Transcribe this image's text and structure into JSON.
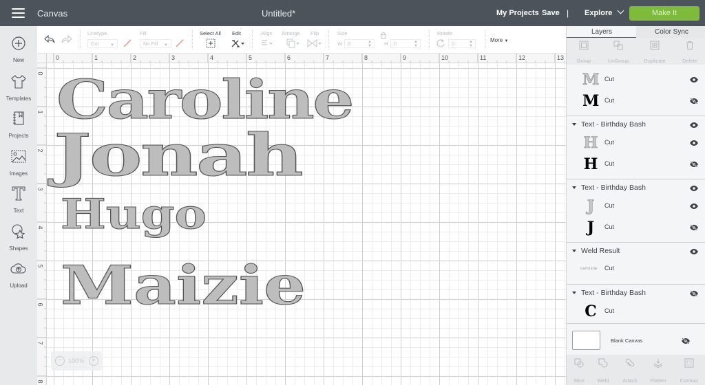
{
  "header": {
    "app_name": "Canvas",
    "doc_title": "Untitled*",
    "my_projects": "My Projects",
    "save": "Save",
    "separator": "|",
    "explore": "Explore",
    "make_it": "Make It",
    "bg_color": "#4c535a",
    "accent_color": "#7dbb3a"
  },
  "sidebar": {
    "items": [
      {
        "label": "New",
        "icon": "plus-circle-icon"
      },
      {
        "label": "Templates",
        "icon": "tshirt-icon"
      },
      {
        "label": "Projects",
        "icon": "notebook-icon"
      },
      {
        "label": "Images",
        "icon": "image-icon"
      },
      {
        "label": "Text",
        "icon": "text-icon"
      },
      {
        "label": "Shapes",
        "icon": "shapes-icon"
      },
      {
        "label": "Upload",
        "icon": "cloud-upload-icon"
      }
    ]
  },
  "toolbar": {
    "linetype_label": "Linetype",
    "linetype_value": "Cut",
    "fill_label": "Fill",
    "fill_value": "No Fill",
    "select_all": "Select All",
    "edit": "Edit",
    "align": "Align",
    "arrange": "Arrange",
    "flip": "Flip",
    "size": "Size",
    "w_label": "W",
    "w_value": "0",
    "h_label": "H",
    "h_value": "0",
    "rotate": "Rotate",
    "rotate_value": "0",
    "more": "More"
  },
  "rulers": {
    "horizontal": [
      "0",
      "1",
      "2",
      "3",
      "4",
      "5",
      "6",
      "7",
      "8",
      "9",
      "10",
      "11",
      "12",
      "13"
    ],
    "vertical": [
      "0",
      "1",
      "2",
      "3",
      "4",
      "5",
      "6",
      "7",
      "8"
    ]
  },
  "canvas": {
    "names": [
      "Caroline",
      "Jonah",
      "Hugo",
      "Maizie"
    ],
    "zoom_level": "100%",
    "zoom_out": "−",
    "zoom_in": "+"
  },
  "panel": {
    "tabs": [
      "Layers",
      "Color Sync"
    ],
    "tools": [
      "Group",
      "UnGroup",
      "Duplicate",
      "Delete"
    ],
    "groups": [
      {
        "name": "Text - Birthday Bash",
        "visible": true,
        "partial": true,
        "rows": [
          {
            "thumb": "M",
            "style": "gray",
            "label": "Cut",
            "visible": true
          },
          {
            "thumb": "M",
            "style": "black",
            "label": "Cut",
            "visible": false
          }
        ]
      },
      {
        "name": "Text - Birthday Bash",
        "visible": true,
        "rows": [
          {
            "thumb": "H",
            "style": "gray",
            "label": "Cut",
            "visible": true
          },
          {
            "thumb": "H",
            "style": "black",
            "label": "Cut",
            "visible": false
          }
        ]
      },
      {
        "name": "Text - Birthday Bash",
        "visible": true,
        "rows": [
          {
            "thumb": "J",
            "style": "gray",
            "label": "Cut",
            "visible": true
          },
          {
            "thumb": "J",
            "style": "black",
            "label": "Cut",
            "visible": false
          }
        ]
      },
      {
        "name": "Weld Result",
        "visible": true,
        "rows": [
          {
            "thumb": "caroline",
            "style": "mini",
            "label": "Cut",
            "visible": null
          }
        ]
      },
      {
        "name": "Text - Birthday Bash",
        "visible": false,
        "rows": [
          {
            "thumb": "C",
            "style": "black",
            "label": "Cut",
            "visible": null
          }
        ]
      }
    ],
    "blank_canvas": "Blank Canvas",
    "bottom_tools": [
      "Slice",
      "Weld",
      "Attach",
      "Flatten",
      "Contour"
    ]
  }
}
